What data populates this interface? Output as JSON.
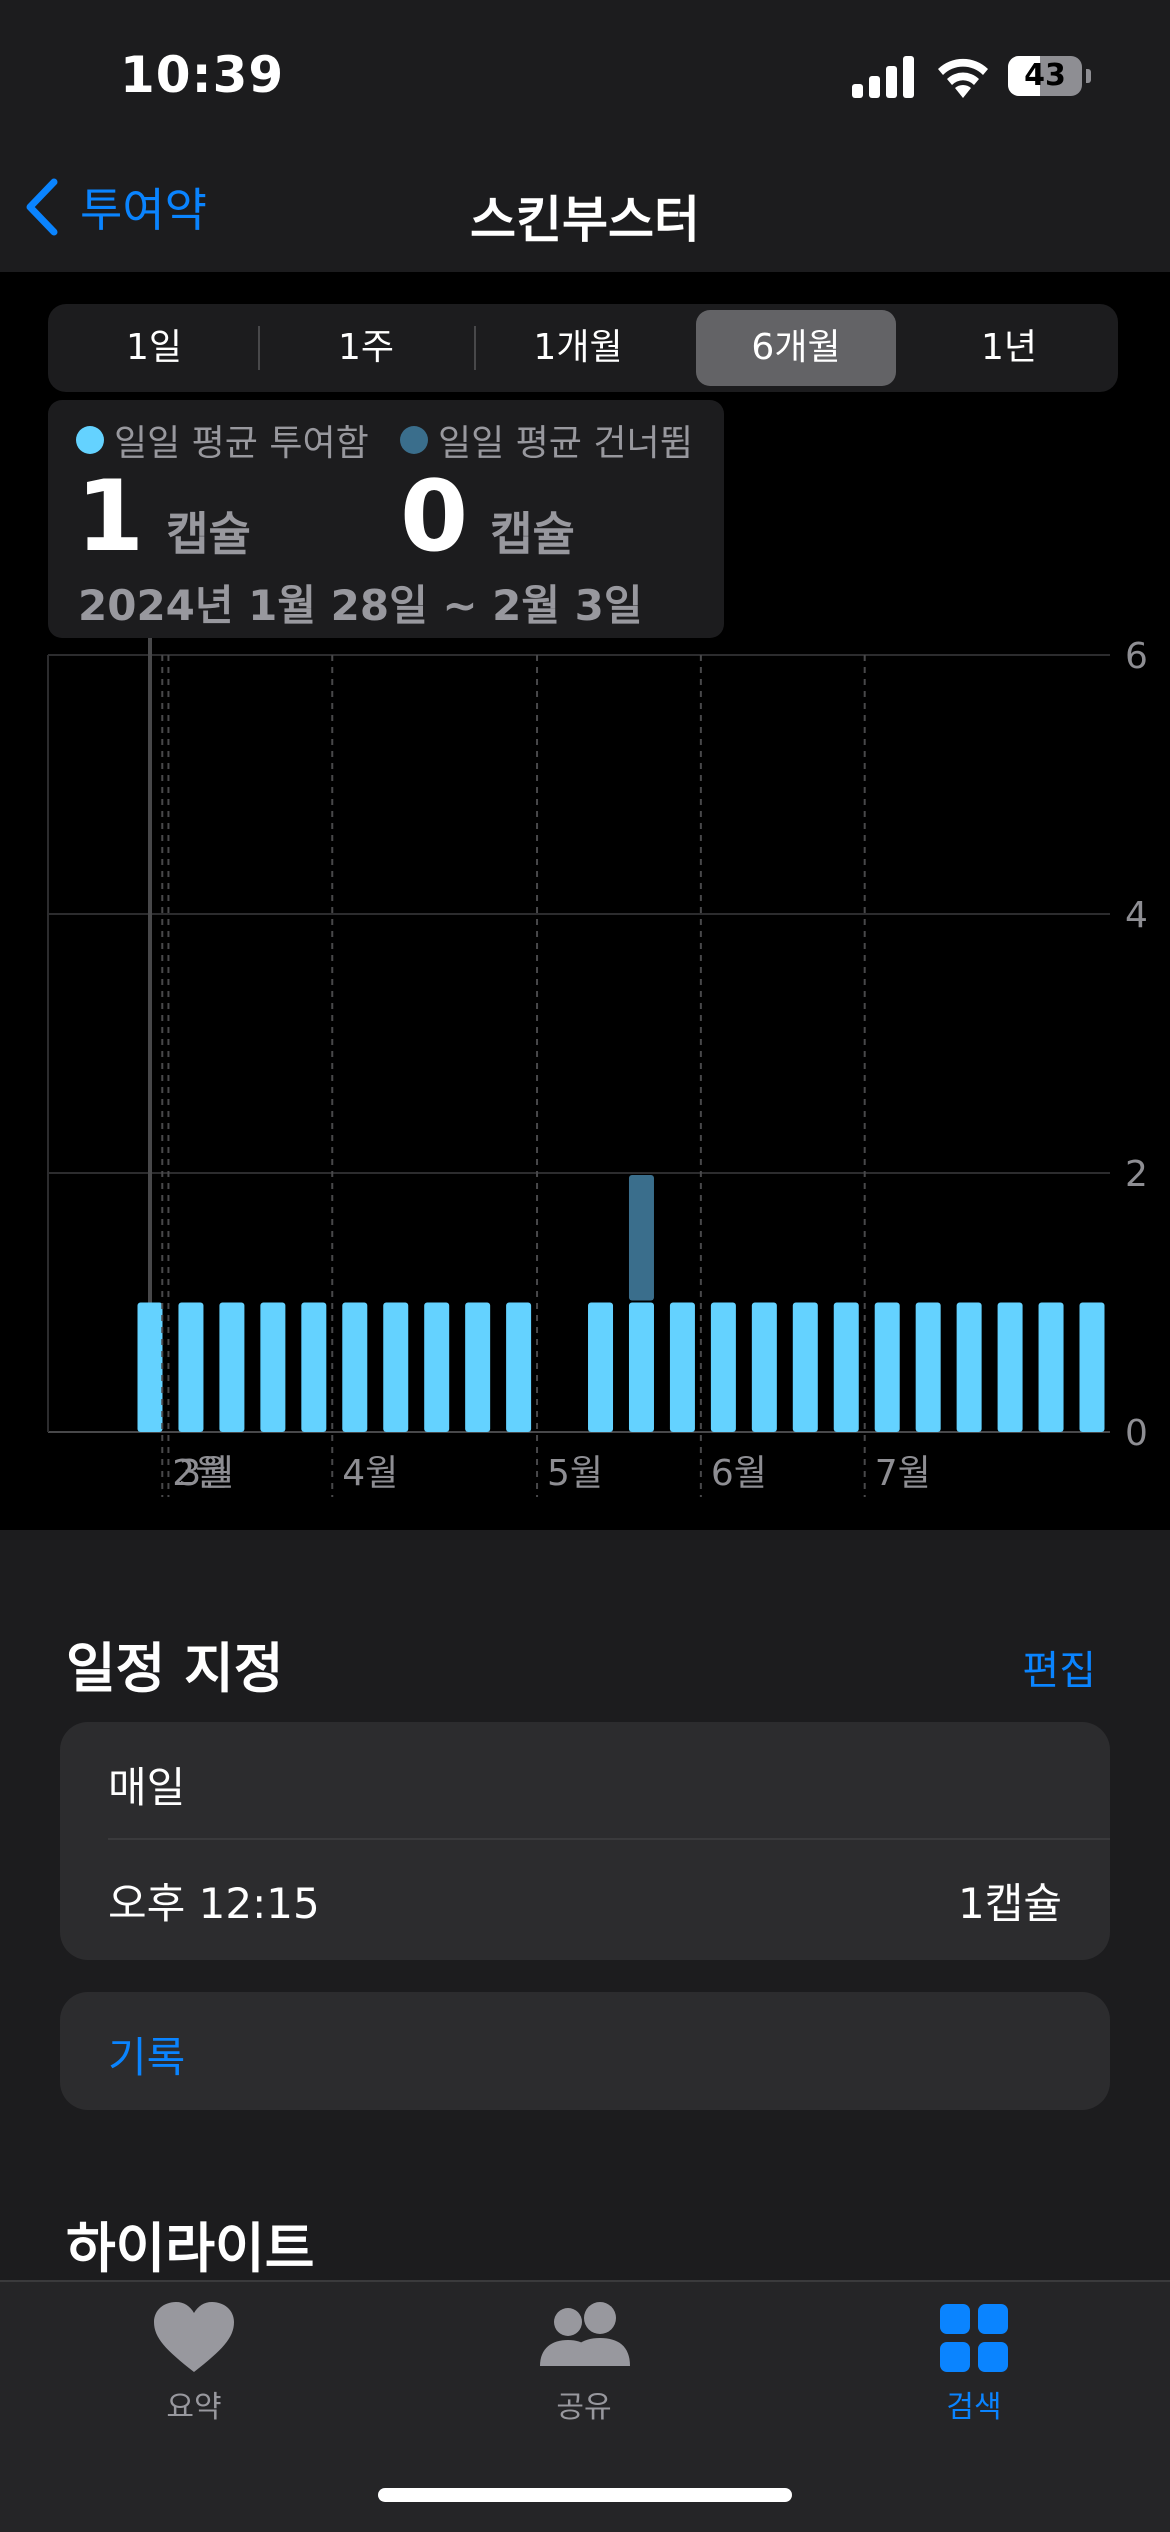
{
  "status_bar": {
    "time": "10:39",
    "battery_level": "43",
    "battery_fraction": 0.43
  },
  "nav": {
    "back_label": "투여약",
    "title": "스킨부스터"
  },
  "segments": {
    "items": [
      "1일",
      "1주",
      "1개월",
      "6개월",
      "1년"
    ],
    "selected": "6개월"
  },
  "summary": {
    "legend_taken": "일일 평균 투여함",
    "legend_skipped": "일일 평균 건너뜀",
    "taken_value": "1",
    "skipped_value": "0",
    "unit": "캡슐",
    "date_range": "2024년 1월 28일 ~ 2월 3일"
  },
  "colors": {
    "accent": "#0a84ff",
    "taken": "#64d2ff",
    "skipped": "#3a6e8c"
  },
  "chart_data": {
    "type": "bar",
    "stacked": true,
    "ylim": [
      0,
      6
    ],
    "y_ticks": [
      "0",
      "2",
      "4",
      "6"
    ],
    "x_ticks": [
      "2월",
      "3월",
      "4월",
      "5월",
      "6월",
      "7월"
    ],
    "categories": [
      "2024-01-28",
      "2024-02-04",
      "2024-02-11",
      "2024-02-18",
      "2024-02-25",
      "2024-03-03",
      "2024-03-10",
      "2024-03-17",
      "2024-03-24",
      "2024-03-31",
      "2024-04-07",
      "2024-04-14",
      "2024-04-21",
      "2024-04-28",
      "2024-05-05",
      "2024-05-12",
      "2024-05-19",
      "2024-05-26",
      "2024-06-02",
      "2024-06-09",
      "2024-06-16",
      "2024-06-23",
      "2024-06-30",
      "2024-07-07"
    ],
    "series": [
      {
        "name": "일일 평균 투여함",
        "values": [
          1,
          1,
          1,
          1,
          1,
          1,
          1,
          1,
          1,
          1,
          0,
          1,
          1,
          1,
          1,
          1,
          1,
          1,
          1,
          1,
          1,
          1,
          1,
          1
        ]
      },
      {
        "name": "일일 평균 건너뜀",
        "values": [
          0,
          0,
          0,
          0,
          0,
          0,
          0,
          0,
          0,
          0,
          0,
          0,
          1,
          0,
          0,
          0,
          0,
          0,
          0,
          0,
          0,
          0,
          0,
          0
        ]
      }
    ],
    "selected_category": "2024-01-28",
    "grid": true
  },
  "schedule": {
    "title": "일정 지정",
    "edit_label": "편집",
    "frequency": "매일",
    "time": "오후 12:15",
    "dose": "1캡슐"
  },
  "log": {
    "label": "기록"
  },
  "highlights": {
    "title": "하이라이트"
  },
  "tab_bar": {
    "summary": "요약",
    "sharing": "공유",
    "browse": "검색"
  }
}
